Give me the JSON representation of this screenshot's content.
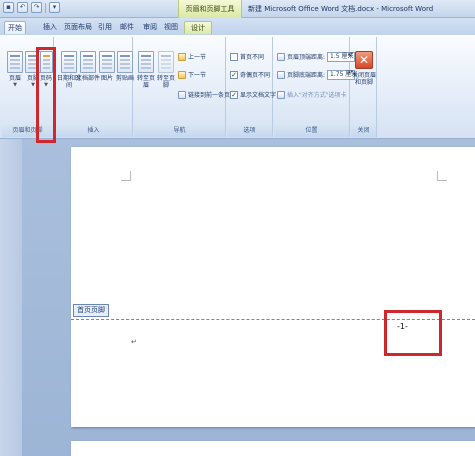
{
  "window": {
    "title": "新建 Microsoft Office Word 文档.docx - Microsoft Word",
    "context_tab_title": "页眉和页脚工具"
  },
  "tabs": [
    "开始",
    "插入",
    "页面布局",
    "引用",
    "邮件",
    "审阅",
    "视图",
    "设计"
  ],
  "ribbon": {
    "groups": [
      {
        "label": "页眉和页脚",
        "buttons": [
          "页眉",
          "页脚",
          "页码"
        ]
      },
      {
        "label": "插入",
        "buttons": [
          "日期和时间",
          "文档部件",
          "图片",
          "剪贴画"
        ]
      },
      {
        "label": "导航",
        "buttons": [
          "转至页眉",
          "转至页脚"
        ],
        "small": [
          "上一节",
          "下一节",
          "链接到前一条页眉"
        ]
      },
      {
        "label": "选项",
        "checks": [
          "首页不同",
          "奇偶页不同",
          "显示文档文字"
        ]
      },
      {
        "label": "位置",
        "fields": [
          {
            "label": "页眉顶端距离:",
            "value": "1.5 厘米"
          },
          {
            "label": "页脚底端距离:",
            "value": "1.75 厘米"
          }
        ],
        "small": "插入\"对齐方式\"选项卡"
      },
      {
        "label": "关闭",
        "buttons": [
          "关闭页眉和页脚"
        ]
      }
    ]
  },
  "document": {
    "footer_tag": "首页页脚",
    "page_number": "-1-"
  }
}
